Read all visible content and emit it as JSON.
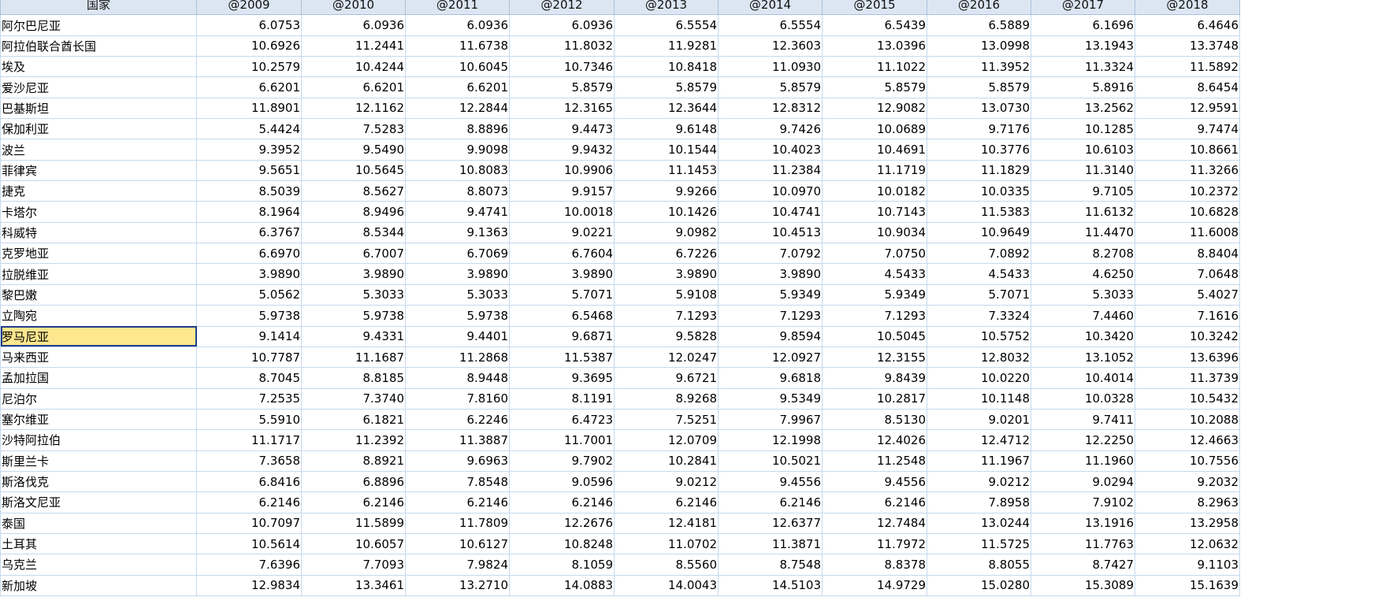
{
  "columns": [
    "国家",
    "@2009",
    "@2010",
    "@2011",
    "@2012",
    "@2013",
    "@2014",
    "@2015",
    "@2016",
    "@2017",
    "@2018"
  ],
  "selected_country": "罗马尼亚",
  "rows": [
    {
      "country": "阿尔巴尼亚",
      "values": [
        "6.0753",
        "6.0936",
        "6.0936",
        "6.0936",
        "6.5554",
        "6.5554",
        "6.5439",
        "6.5889",
        "6.1696",
        "6.4646"
      ]
    },
    {
      "country": "阿拉伯联合酋长国",
      "values": [
        "10.6926",
        "11.2441",
        "11.6738",
        "11.8032",
        "11.9281",
        "12.3603",
        "13.0396",
        "13.0998",
        "13.1943",
        "13.3748"
      ]
    },
    {
      "country": "埃及",
      "values": [
        "10.2579",
        "10.4244",
        "10.6045",
        "10.7346",
        "10.8418",
        "11.0930",
        "11.1022",
        "11.3952",
        "11.3324",
        "11.5892"
      ]
    },
    {
      "country": "爱沙尼亚",
      "values": [
        "6.6201",
        "6.6201",
        "6.6201",
        "5.8579",
        "5.8579",
        "5.8579",
        "5.8579",
        "5.8579",
        "5.8916",
        "8.6454"
      ]
    },
    {
      "country": "巴基斯坦",
      "values": [
        "11.8901",
        "12.1162",
        "12.2844",
        "12.3165",
        "12.3644",
        "12.8312",
        "12.9082",
        "13.0730",
        "13.2562",
        "12.9591"
      ]
    },
    {
      "country": "保加利亚",
      "values": [
        "5.4424",
        "7.5283",
        "8.8896",
        "9.4473",
        "9.6148",
        "9.7426",
        "10.0689",
        "9.7176",
        "10.1285",
        "9.7474"
      ]
    },
    {
      "country": "波兰",
      "values": [
        "9.3952",
        "9.5490",
        "9.9098",
        "9.9432",
        "10.1544",
        "10.4023",
        "10.4691",
        "10.3776",
        "10.6103",
        "10.8661"
      ]
    },
    {
      "country": "菲律宾",
      "values": [
        "9.5651",
        "10.5645",
        "10.8083",
        "10.9906",
        "11.1453",
        "11.2384",
        "11.1719",
        "11.1829",
        "11.3140",
        "11.3266"
      ]
    },
    {
      "country": "捷克",
      "values": [
        "8.5039",
        "8.5627",
        "8.8073",
        "9.9157",
        "9.9266",
        "10.0970",
        "10.0182",
        "10.0335",
        "9.7105",
        "10.2372"
      ]
    },
    {
      "country": "卡塔尔",
      "values": [
        "8.1964",
        "8.9496",
        "9.4741",
        "10.0018",
        "10.1426",
        "10.4741",
        "10.7143",
        "11.5383",
        "11.6132",
        "10.6828"
      ]
    },
    {
      "country": "科威特",
      "values": [
        "6.3767",
        "8.5344",
        "9.1363",
        "9.0221",
        "9.0982",
        "10.4513",
        "10.9034",
        "10.9649",
        "11.4470",
        "11.6008"
      ]
    },
    {
      "country": "克罗地亚",
      "values": [
        "6.6970",
        "6.7007",
        "6.7069",
        "6.7604",
        "6.7226",
        "7.0792",
        "7.0750",
        "7.0892",
        "8.2708",
        "8.8404"
      ]
    },
    {
      "country": "拉脱维亚",
      "values": [
        "3.9890",
        "3.9890",
        "3.9890",
        "3.9890",
        "3.9890",
        "3.9890",
        "4.5433",
        "4.5433",
        "4.6250",
        "7.0648"
      ]
    },
    {
      "country": "黎巴嫩",
      "values": [
        "5.0562",
        "5.3033",
        "5.3033",
        "5.7071",
        "5.9108",
        "5.9349",
        "5.9349",
        "5.7071",
        "5.3033",
        "5.4027"
      ]
    },
    {
      "country": "立陶宛",
      "values": [
        "5.9738",
        "5.9738",
        "5.9738",
        "6.5468",
        "7.1293",
        "7.1293",
        "7.1293",
        "7.3324",
        "7.4460",
        "7.1616"
      ]
    },
    {
      "country": "罗马尼亚",
      "values": [
        "9.1414",
        "9.4331",
        "9.4401",
        "9.6871",
        "9.5828",
        "9.8594",
        "10.5045",
        "10.5752",
        "10.3420",
        "10.3242"
      ]
    },
    {
      "country": "马来西亚",
      "values": [
        "10.7787",
        "11.1687",
        "11.2868",
        "11.5387",
        "12.0247",
        "12.0927",
        "12.3155",
        "12.8032",
        "13.1052",
        "13.6396"
      ]
    },
    {
      "country": "孟加拉国",
      "values": [
        "8.7045",
        "8.8185",
        "8.9448",
        "9.3695",
        "9.6721",
        "9.6818",
        "9.8439",
        "10.0220",
        "10.4014",
        "11.3739"
      ]
    },
    {
      "country": "尼泊尔",
      "values": [
        "7.2535",
        "7.3740",
        "7.8160",
        "8.1191",
        "8.9268",
        "9.5349",
        "10.2817",
        "10.1148",
        "10.0328",
        "10.5432"
      ]
    },
    {
      "country": "塞尔维亚",
      "values": [
        "5.5910",
        "6.1821",
        "6.2246",
        "6.4723",
        "7.5251",
        "7.9967",
        "8.5130",
        "9.0201",
        "9.7411",
        "10.2088"
      ]
    },
    {
      "country": "沙特阿拉伯",
      "values": [
        "11.1717",
        "11.2392",
        "11.3887",
        "11.7001",
        "12.0709",
        "12.1998",
        "12.4026",
        "12.4712",
        "12.2250",
        "12.4663"
      ]
    },
    {
      "country": "斯里兰卡",
      "values": [
        "7.3658",
        "8.8921",
        "9.6963",
        "9.7902",
        "10.2841",
        "10.5021",
        "11.2548",
        "11.1967",
        "11.1960",
        "10.7556"
      ]
    },
    {
      "country": "斯洛伐克",
      "values": [
        "6.8416",
        "6.8896",
        "7.8548",
        "9.0596",
        "9.0212",
        "9.4556",
        "9.4556",
        "9.0212",
        "9.0294",
        "9.2032"
      ]
    },
    {
      "country": "斯洛文尼亚",
      "values": [
        "6.2146",
        "6.2146",
        "6.2146",
        "6.2146",
        "6.2146",
        "6.2146",
        "6.2146",
        "7.8958",
        "7.9102",
        "8.2963"
      ]
    },
    {
      "country": "泰国",
      "values": [
        "10.7097",
        "11.5899",
        "11.7809",
        "12.2676",
        "12.4181",
        "12.6377",
        "12.7484",
        "13.0244",
        "13.1916",
        "13.2958"
      ]
    },
    {
      "country": "土耳其",
      "values": [
        "10.5614",
        "10.6057",
        "10.6127",
        "10.8248",
        "11.0702",
        "11.3871",
        "11.7972",
        "11.5725",
        "11.7763",
        "12.0632"
      ]
    },
    {
      "country": "乌克兰",
      "values": [
        "7.6396",
        "7.7093",
        "7.9824",
        "8.1059",
        "8.5560",
        "8.7548",
        "8.8378",
        "8.8055",
        "8.7427",
        "9.1103"
      ]
    },
    {
      "country": "新加坡",
      "values": [
        "12.9834",
        "13.3461",
        "13.2710",
        "14.0883",
        "14.0043",
        "14.5103",
        "14.9729",
        "15.0280",
        "15.3089",
        "15.1639"
      ]
    }
  ]
}
